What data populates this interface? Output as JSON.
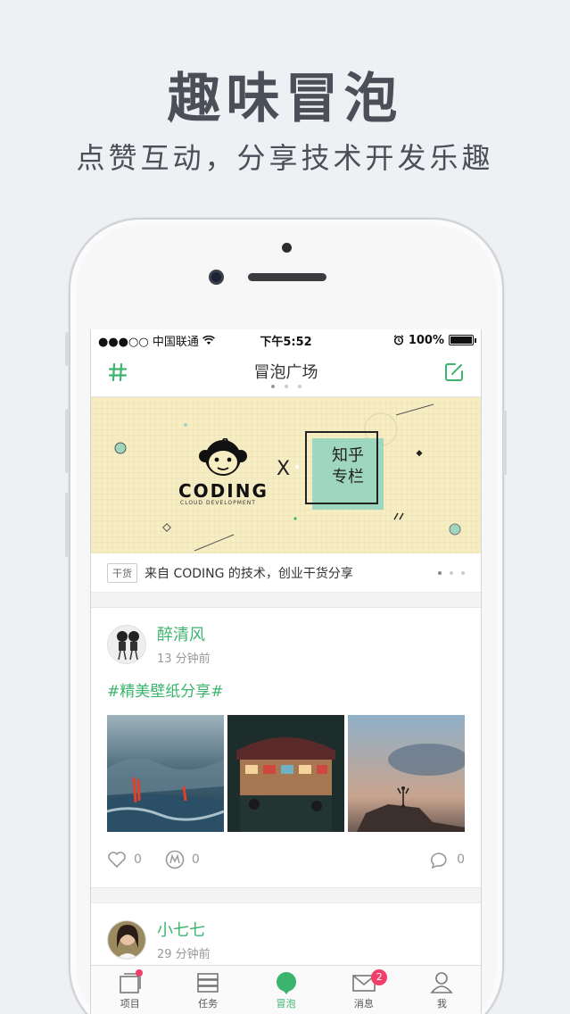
{
  "promo": {
    "title": "趣味冒泡",
    "subtitle": "点赞互动，分享技术开发乐趣"
  },
  "status_bar": {
    "carrier": "●●●○○ 中国联通",
    "time": "下午5:52",
    "battery": "100%",
    "battery_level": 1.0
  },
  "nav": {
    "title": "冒泡广场",
    "left_icon": "hashtag-icon",
    "right_icon": "compose-icon"
  },
  "banner": {
    "brand": "CODING",
    "brand_sub": "CLOUD DEVELOPMENT",
    "x": "X",
    "partner_line1": "知乎",
    "partner_line2": "专栏",
    "colors": {
      "background": "#f7edc2",
      "partner": "#9fd6c0"
    }
  },
  "notice": {
    "tag": "干货",
    "text": "来自 CODING 的技术，创业干货分享"
  },
  "posts": [
    {
      "author": "醉清风",
      "time": "13 分钟前",
      "topic": "#精美壁纸分享#",
      "likes": "0",
      "rewards": "0",
      "comments": "0"
    },
    {
      "author": "小七七",
      "time": "29 分钟前"
    }
  ],
  "tabbar": {
    "items": [
      {
        "label": "项目",
        "icon": "project-icon"
      },
      {
        "label": "任务",
        "icon": "task-icon"
      },
      {
        "label": "冒泡",
        "icon": "bubble-icon"
      },
      {
        "label": "消息",
        "icon": "message-icon",
        "badge": "2"
      },
      {
        "label": "我",
        "icon": "profile-icon"
      }
    ]
  },
  "accent_color": "#3bb56e"
}
